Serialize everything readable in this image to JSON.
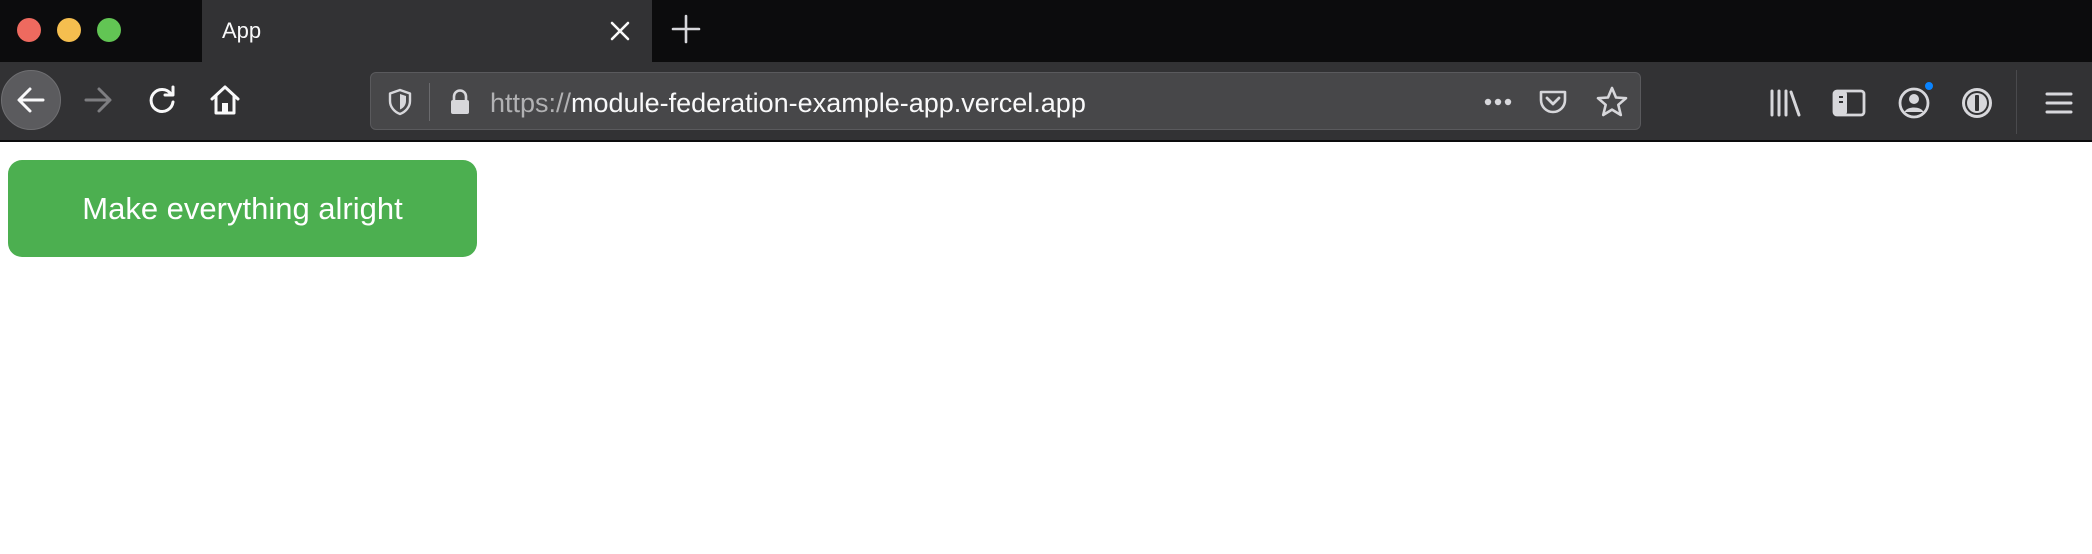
{
  "window": {
    "controls": [
      "close",
      "minimize",
      "maximize"
    ],
    "colors": {
      "close": "#ee6a5f",
      "minimize": "#f5be4f",
      "maximize": "#62c554"
    }
  },
  "tab": {
    "title": "App",
    "close_icon": "close-icon"
  },
  "new_tab_icon": "plus-icon",
  "navigation": {
    "back_icon": "arrow-left-icon",
    "forward_icon": "arrow-right-icon",
    "reload_icon": "reload-icon",
    "home_icon": "home-icon"
  },
  "urlbar": {
    "scheme": "https://",
    "host": "module-federation-example-app.vercel.app",
    "icons": [
      "shield-icon",
      "lock-icon",
      "more-icon",
      "pocket-icon",
      "star-icon"
    ]
  },
  "toolbar": {
    "icons": [
      "library-icon",
      "sidebar-icon",
      "account-icon",
      "password-manager-icon",
      "hamburger-menu-icon"
    ],
    "notification_color": "#0a84ff"
  },
  "page": {
    "button_label": "Make everything alright",
    "button_color": "#4caf50"
  }
}
